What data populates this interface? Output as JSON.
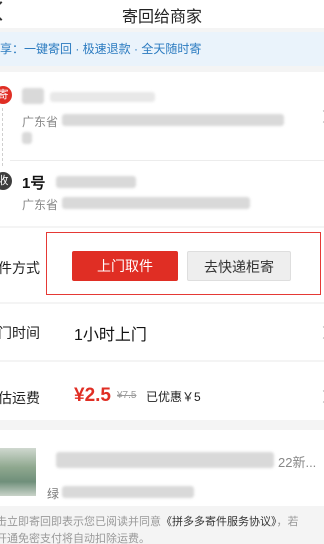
{
  "header": {
    "title": "寄回给商家"
  },
  "notice": {
    "text": "享：一键寄回 · 极速退款 · 全天随时寄"
  },
  "sender": {
    "badge": "寄",
    "province": "广东省"
  },
  "receiver": {
    "badge": "收",
    "name": "1号",
    "province": "广东省"
  },
  "method": {
    "label": "件方式",
    "options": [
      {
        "label": "上门取件",
        "selected": true
      },
      {
        "label": "去快递柜寄",
        "selected": false
      }
    ]
  },
  "pickup_time": {
    "label": "门时间",
    "value": "1小时上门"
  },
  "fee": {
    "label": "估运费",
    "price": "¥2.5",
    "original": "¥7.5",
    "discount": "已优惠￥5"
  },
  "goods": {
    "date_suffix": "22新...",
    "sub_prefix": "绿"
  },
  "agreement": {
    "line1_prefix": "击立即寄回即表示您已阅读并同意",
    "line1_link": "《拼多多寄件服务协议》",
    "line1_suffix": "，若",
    "line2": "开通免密支付将自动扣除运费。"
  },
  "colors": {
    "accent": "#e02e24",
    "notice_text": "#2b7bc0",
    "notice_bg": "#eaf3fb"
  }
}
